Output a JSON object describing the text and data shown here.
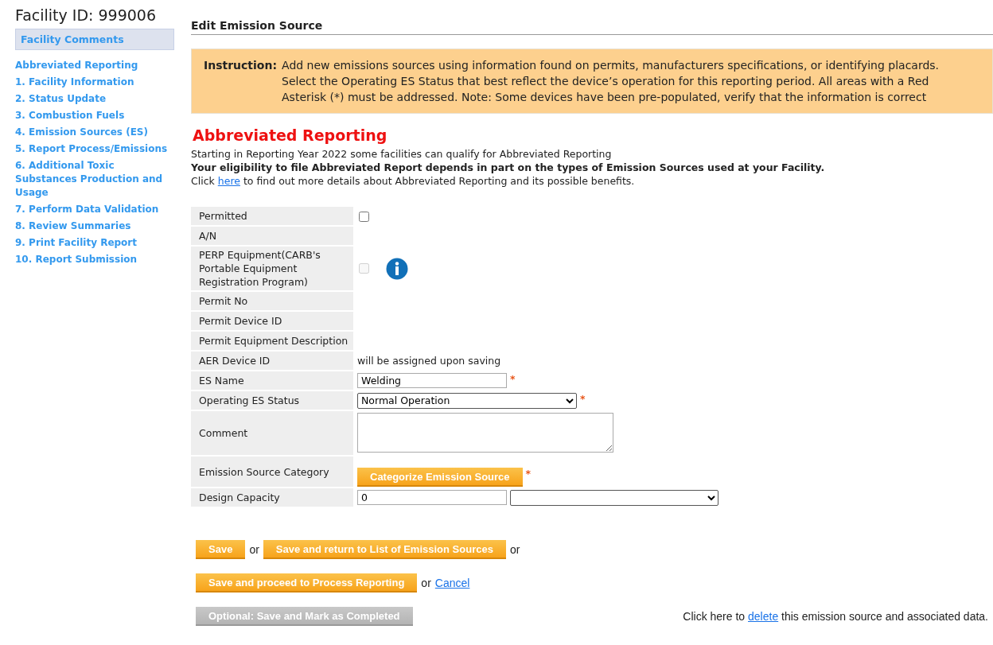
{
  "sidebar": {
    "facility_title": "Facility ID: 999006",
    "comments_link": "Facility Comments",
    "items": [
      {
        "label": "Abbreviated Reporting"
      },
      {
        "label": "1. Facility Information"
      },
      {
        "label": "2. Status Update"
      },
      {
        "label": "3. Combustion Fuels"
      },
      {
        "label": "4. Emission Sources (ES)"
      },
      {
        "label": "5. Report Process/Emissions"
      },
      {
        "label": "6. Additional Toxic Substances Production and Usage"
      },
      {
        "label": "7. Perform Data Validation"
      },
      {
        "label": "8. Review Summaries"
      },
      {
        "label": "9. Print Facility Report"
      },
      {
        "label": "10. Report Submission"
      }
    ]
  },
  "page_title": "Edit Emission Source",
  "instruction": {
    "label": "Instruction:",
    "text": "Add new emissions sources using information found on permits, manufacturers specifications, or identifying placards. Select the Operating ES Status that best reflect the device’s operation for this reporting period. All areas with a Red Asterisk (*) must be addressed. Note: Some devices have been pre-populated, verify that the information is correct"
  },
  "abbreviated": {
    "heading": "Abbreviated Reporting",
    "line_1": "Starting in Reporting Year 2022 some facilities can qualify for Abbreviated Reporting",
    "line_2": "Your eligibility to file Abbreviated Report depends in part on the types of Emission Sources used at your Facility.",
    "line_3_before": "Click ",
    "line_3_link": "here",
    "line_3_after": " to find out more details about Abbreviated Reporting and its possible benefits."
  },
  "form": [
    {
      "label": "Permitted",
      "kind": "checkbox",
      "checked": false,
      "disabled": false
    },
    {
      "label": "A/N",
      "kind": "empty"
    },
    {
      "label": "PERP Equipment(CARB's Portable Equipment Registration Program)",
      "kind": "checkbox_info",
      "checked": false,
      "disabled": true
    },
    {
      "label": "Permit No",
      "kind": "empty"
    },
    {
      "label": "Permit Device ID",
      "kind": "empty"
    },
    {
      "label": "Permit Equipment Description",
      "kind": "empty"
    },
    {
      "label": "AER Device ID",
      "kind": "text",
      "text": "will be assigned upon saving"
    },
    {
      "label": "ES Name",
      "kind": "input",
      "value": "Welding",
      "required": true,
      "required_mark": "*"
    },
    {
      "label": "Operating ES Status",
      "kind": "select",
      "value": "Normal Operation",
      "required": true,
      "required_mark": "*"
    },
    {
      "label": "Comment",
      "kind": "textarea"
    },
    {
      "label": "Emission Source Category",
      "kind": "button",
      "button": "Categorize Emission Source",
      "required": true,
      "required_mark": "*"
    },
    {
      "label": "Design Capacity",
      "kind": "capacity",
      "value": "0"
    }
  ],
  "actions": [
    [
      {
        "kind": "button",
        "label": "Save",
        "disabled": false
      },
      {
        "kind": "text",
        "text": "or"
      },
      {
        "kind": "button",
        "label": "Save and return to List of Emission Sources",
        "disabled": false
      },
      {
        "kind": "text",
        "text": "or"
      }
    ],
    [
      {
        "kind": "button",
        "label": "Save and proceed to Process Reporting",
        "disabled": false
      },
      {
        "kind": "text",
        "text": "or"
      },
      {
        "kind": "link",
        "text": "Cancel"
      }
    ],
    [
      {
        "kind": "button",
        "label": "Optional: Save and Mark as Completed",
        "disabled": true
      }
    ]
  ],
  "delete_note": {
    "before": "Click here to ",
    "link": "delete",
    "after": " this emission source and associated data."
  }
}
